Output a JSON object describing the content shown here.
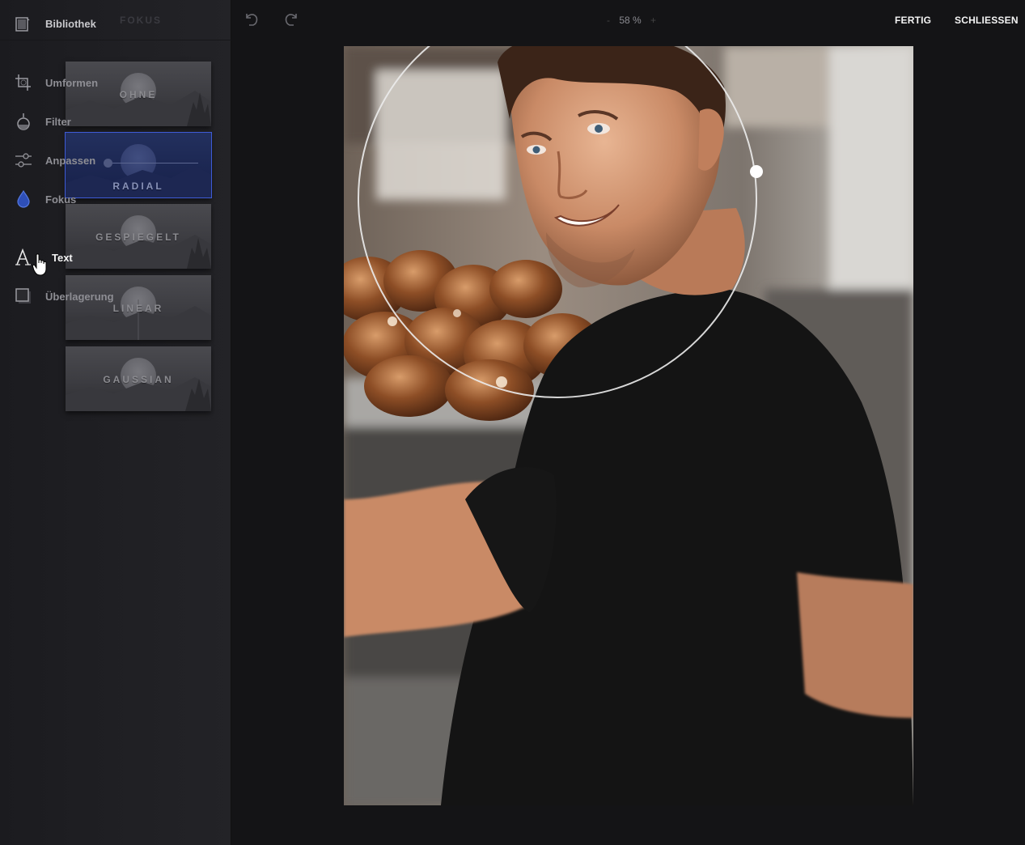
{
  "sidebar": {
    "library_label": "Bibliothek",
    "panel_title": "FOKUS",
    "nav": {
      "transform": "Umformen",
      "filter": "Filter",
      "adjust": "Anpassen",
      "focus": "Fokus",
      "text": "Text",
      "overlay": "Überlagerung"
    },
    "presets": {
      "none": "OHNE",
      "radial": "RADIAL",
      "mirrored": "GESPIEGELT",
      "linear": "LINEAR",
      "gaussian": "GAUSSIAN"
    },
    "selected_preset": "RADIAL",
    "accent_color": "#3e5bd6"
  },
  "toolbar": {
    "zoom_out": "-",
    "zoom_value": "58 %",
    "zoom_in": "+",
    "done": "FERTIG",
    "close": "SCHLIESSEN"
  },
  "icons": {
    "library": "book-icon",
    "transform": "crop-icon",
    "filter": "flask-icon",
    "adjust": "sliders-icon",
    "focus": "drop-icon",
    "text": "text-icon",
    "overlay": "square-icon",
    "undo": "undo-icon",
    "redo": "redo-icon"
  }
}
